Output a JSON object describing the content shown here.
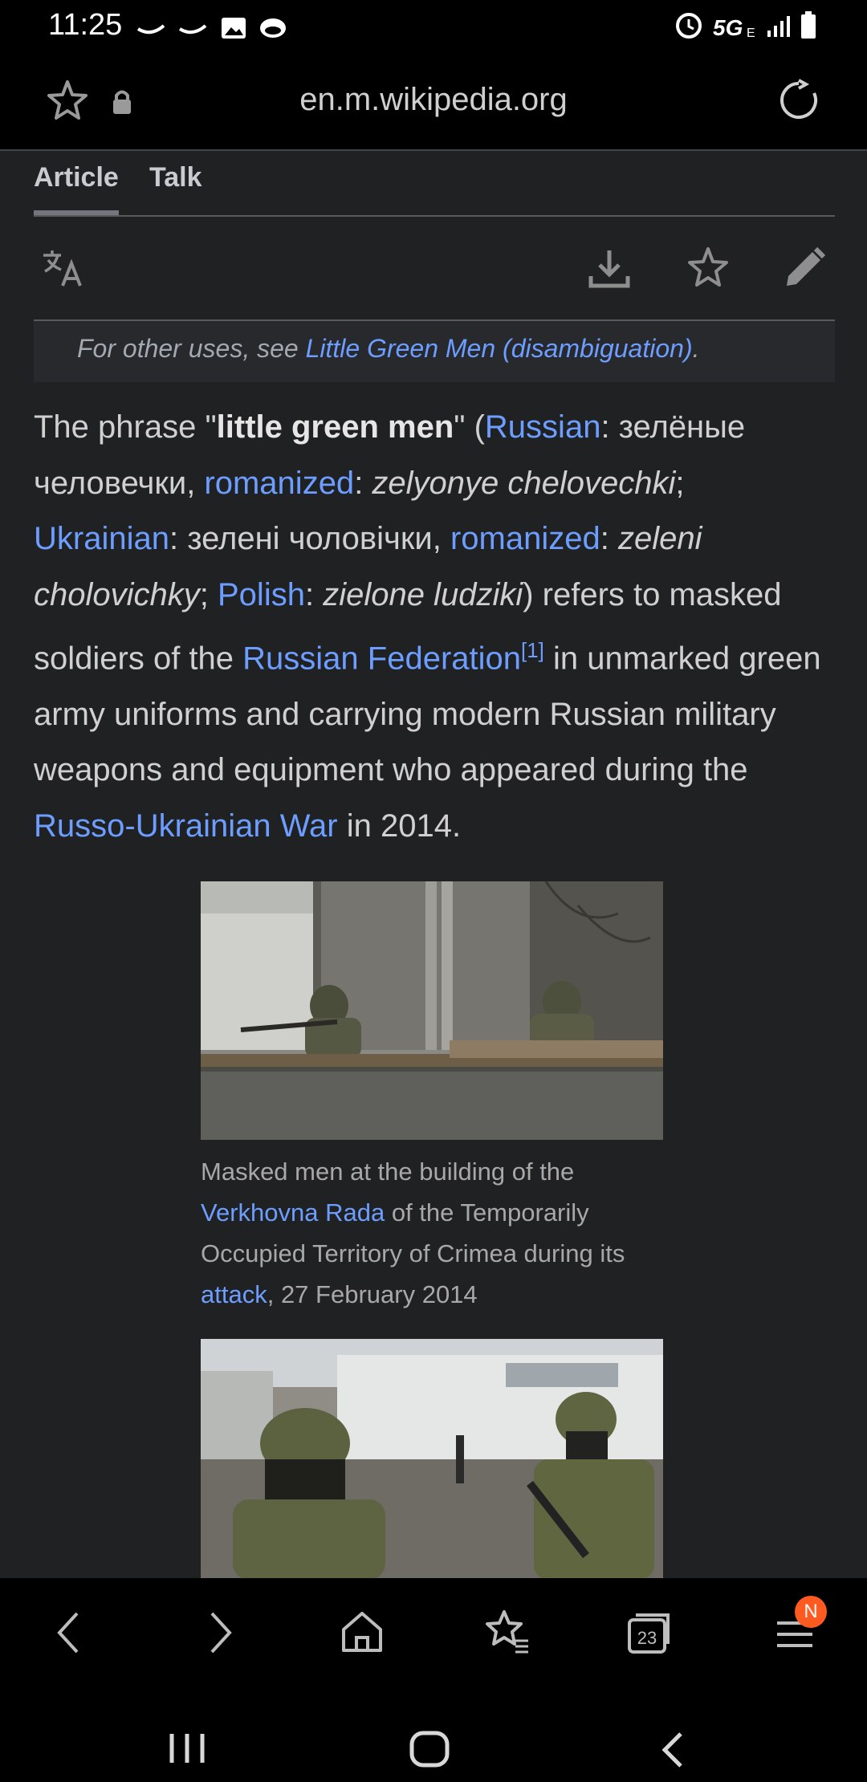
{
  "status_bar": {
    "time": "11:25",
    "network": "5G"
  },
  "browser": {
    "url": "en.m.wikipedia.org",
    "tabs_count": "23",
    "menu_badge": "N"
  },
  "article": {
    "tabs": [
      "Article",
      "Talk"
    ],
    "hatnote_prefix": "For other uses, see ",
    "hatnote_link": "Little Green Men (disambiguation)",
    "hatnote_suffix": ".",
    "p": {
      "t1": "The phrase \"",
      "bold": "little green men",
      "t2": "\" (",
      "l_russian": "Russian",
      "t3": ": зелёные человечки, ",
      "l_romanized1": "romanized",
      "t4": ": ",
      "i_zel": "zelyonye chelovechki",
      "t5": "; ",
      "l_ukrainian": "Ukrainian",
      "t6": ": зелені чоловічки, ",
      "l_romanized2": "romanized",
      "t7": ": ",
      "i_zeleni": "zeleni cholovichky",
      "t8": "; ",
      "l_polish": "Polish",
      "t9": ": ",
      "i_zielone": "zielone ludziki",
      "t10": ") refers to masked soldiers of the ",
      "l_russfed": "Russian Federation",
      "ref": "[1]",
      "t11": " in unmarked green army uniforms and carrying modern Russian military weapons and equipment who appeared during the ",
      "l_war": "Russo-Ukrainian War",
      "t12": " in 2014."
    },
    "caption1": {
      "t1": "Masked men at the building of the ",
      "l1": "Verkhovna Rada",
      "t2": " of the Temporarily Occupied Territory of Crimea during its ",
      "l2": "attack",
      "t3": ", 27 February 2014"
    }
  },
  "icons": [
    "bookmark-star-icon",
    "lock-icon",
    "reload-icon",
    "translate-icon",
    "download-icon",
    "watch-star-icon",
    "edit-pencil-icon",
    "back-icon",
    "forward-icon",
    "home-icon",
    "bookmarks-icon",
    "tabs-icon",
    "menu-icon",
    "recents-icon",
    "home-button-icon",
    "sys-back-icon"
  ]
}
